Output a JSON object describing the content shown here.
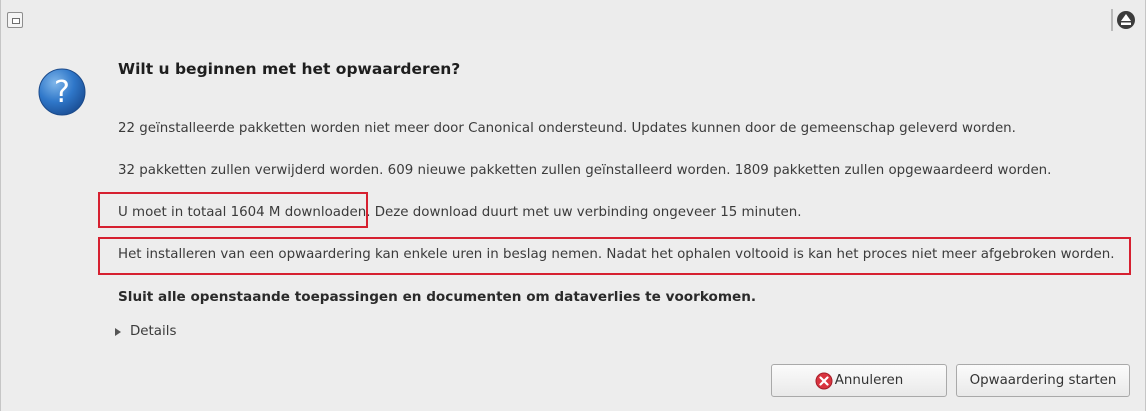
{
  "dialog": {
    "heading": "Wilt u beginnen met het opwaarderen?",
    "lines": [
      "22 geïnstalleerde pakketten worden niet meer door Canonical ondersteund. Updates kunnen door de gemeenschap geleverd worden.",
      "32 pakketten zullen verwijderd worden. 609 nieuwe pakketten zullen geïnstalleerd worden. 1809 pakketten zullen opgewaardeerd worden.",
      "Het installeren van een opwaardering kan enkele uren in beslag nemen. Nadat het ophalen voltooid is kan het proces niet meer afgebroken worden.",
      "Sluit alle openstaande toepassingen en documenten om dataverlies te voorkomen."
    ],
    "download_part1": "U moet in totaal 1604 M downloaden.",
    "download_part2": " Deze download duurt met uw verbinding ongeveer 15 minuten.",
    "details_label": "Details",
    "question_icon": "question-mark",
    "highlight_color": "#d62030"
  },
  "buttons": {
    "cancel_label": "Annuleren",
    "start_label": "Opwaardering starten"
  }
}
